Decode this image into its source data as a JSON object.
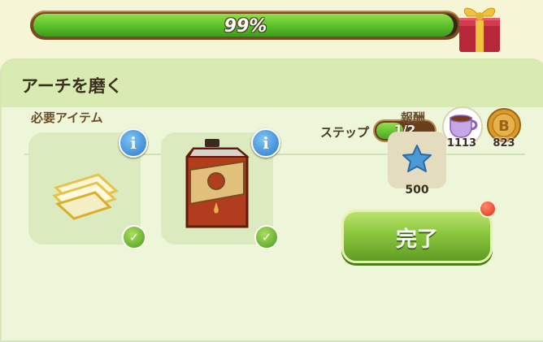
{
  "progress": {
    "percent_text": "99%",
    "fraction": 0.99
  },
  "panel": {
    "title": "アーチを磨く",
    "steps_label": "ステップ",
    "steps_value": "1/2",
    "steps_fraction": 0.5
  },
  "resources": [
    {
      "icon": "teacup-icon",
      "count": "1113"
    },
    {
      "icon": "coin-icon",
      "count": "823"
    }
  ],
  "required": {
    "label": "必要アイテム",
    "items": [
      {
        "icon": "cloth-icon",
        "completed": true
      },
      {
        "icon": "oil-can-icon",
        "completed": true
      }
    ]
  },
  "reward": {
    "label": "報酬",
    "icon": "star-icon",
    "count": "500"
  },
  "actions": {
    "done_label": "完了"
  },
  "colors": {
    "accent_green": "#8cc63f",
    "info_blue": "#2b7ac9",
    "brown": "#6a3d1c"
  }
}
